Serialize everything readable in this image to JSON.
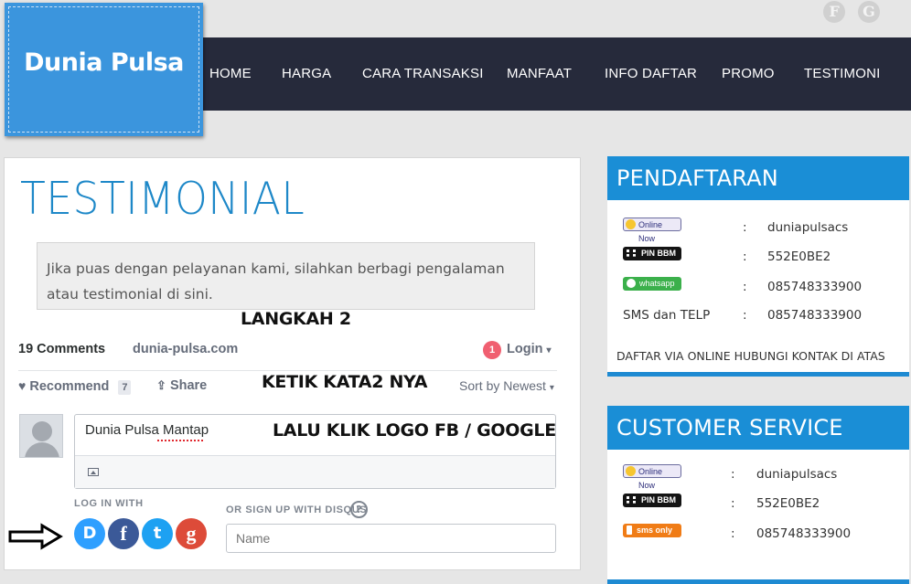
{
  "header": {
    "social": [
      "F",
      "G"
    ],
    "logo": "Dunia Pulsa",
    "nav": [
      "HOME",
      "HARGA",
      "CARA TRANSAKSI",
      "MANFAAT",
      "INFO DAFTAR",
      "PROMO",
      "TESTIMONI"
    ]
  },
  "main": {
    "title": "TESTIMONIAL",
    "intro": "Jika puas dengan pelayanan kami, silahkan berbagi pengalaman atau testimonial di sini."
  },
  "annotations": {
    "step": "LANGKAH 2",
    "type_words": "KETIK KATA2 NYA",
    "click_logo": "LALU KLIK LOGO FB / GOOGLE"
  },
  "disqus": {
    "comments_count": "19 Comments",
    "site": "dunia-pulsa.com",
    "notif_count": "1",
    "login": "Login",
    "recommend": "Recommend",
    "recommend_count": "7",
    "share": "Share",
    "sort": "Sort by Newest",
    "comment_text": "Dunia Pulsa Mantap",
    "login_with": "LOG IN WITH",
    "signup_with": "OR SIGN UP WITH DISQUS",
    "help": "?",
    "name_placeholder": "Name",
    "social_logins": [
      "D",
      "f",
      "t",
      "g"
    ]
  },
  "sidebar": {
    "registration": {
      "title": "PENDAFTARAN",
      "rows": [
        {
          "badge": "Online Now",
          "sep": ":",
          "value": "duniapulsacs"
        },
        {
          "badge": "PIN BBM",
          "sep": ":",
          "value": "552E0BE2"
        },
        {
          "badge": "whatsapp",
          "sep": ":",
          "value": "085748333900"
        },
        {
          "label": "SMS dan TELP",
          "sep": ":",
          "value": "085748333900"
        }
      ],
      "footer": "DAFTAR VIA ONLINE HUBUNGI KONTAK DI ATAS"
    },
    "customer_service": {
      "title": "CUSTOMER SERVICE",
      "rows": [
        {
          "badge": "Online Now",
          "sep": ":",
          "value": "duniapulsacs"
        },
        {
          "badge": "PIN BBM",
          "sep": ":",
          "value": "552E0BE2"
        },
        {
          "badge": "sms only",
          "sep": ":",
          "value": "085748333900"
        }
      ]
    }
  },
  "colors": {
    "nav_bg": "#262a3b",
    "brand_blue": "#3b95dd",
    "widget_blue": "#1a8ed6",
    "facebook": "#3b5998",
    "twitter": "#1da1f2",
    "google": "#dd4b39",
    "disqus": "#2e9fff"
  },
  "icons": [
    "facebook-icon",
    "google-icon",
    "heart-icon",
    "share-icon",
    "chevron-down-icon",
    "image-icon",
    "arrow-right-icon",
    "user-avatar-icon",
    "help-icon"
  ]
}
